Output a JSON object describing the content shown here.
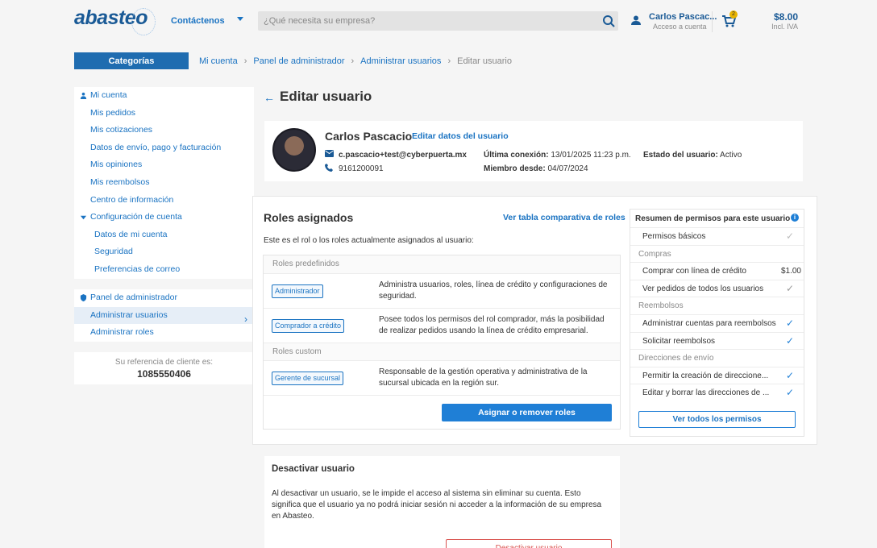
{
  "header": {
    "logo": "abasteo",
    "contact": "Contáctenos",
    "search_placeholder": "¿Qué necesita su empresa?",
    "user_name": "Carlos Pascac...",
    "user_sub": "Acceso a cuenta",
    "cart_count": "2",
    "price": "$8.00",
    "price_sub": "Incl. IVA"
  },
  "nav": {
    "categories": "Categorías",
    "breadcrumbs": [
      "Mi cuenta",
      "Panel de administrador",
      "Administrar usuarios",
      "Editar usuario"
    ]
  },
  "sidebar": {
    "account_head": "Mi cuenta",
    "items": [
      "Mis pedidos",
      "Mis cotizaciones",
      "Datos de envío, pago y facturación",
      "Mis opiniones",
      "Mis reembolsos",
      "Centro de información"
    ],
    "config_head": "Configuración de cuenta",
    "config_items": [
      "Datos de mi cuenta",
      "Seguridad",
      "Preferencias de correo"
    ],
    "admin_head": "Panel de administrador",
    "admin_items": [
      "Administrar usuarios",
      "Administrar roles"
    ],
    "ref_label": "Su referencia de cliente es:",
    "ref_value": "1085550406"
  },
  "page": {
    "title": "Editar usuario"
  },
  "profile": {
    "name": "Carlos Pascacio",
    "edit_link": "Editar datos del usuario",
    "email": "c.pascacio+test@cyberpuerta.mx",
    "phone": "9161200091",
    "last_label": "Última conexión:",
    "last_value": "13/01/2025 11:23 p.m.",
    "since_label": "Miembro desde:",
    "since_value": "04/07/2024",
    "state_label": "Estado del usuario:",
    "state_value": "Activo"
  },
  "roles": {
    "title": "Roles asignados",
    "compare_link": "Ver tabla comparativa de roles",
    "description": "Este es el rol o los roles actualmente asignados al usuario:",
    "predefined_label": "Roles predefinidos",
    "custom_label": "Roles custom",
    "rows": [
      {
        "tag": "Administrador",
        "text": "Administra usuarios, roles, línea de crédito y configuraciones de seguridad."
      },
      {
        "tag": "Comprador a crédito",
        "text": "Posee todos los permisos del rol comprador, más la posibilidad de realizar pedidos usando la línea de crédito empresarial."
      },
      {
        "tag": "Gerente de sucursal",
        "text": "Responsable de la gestión operativa y administrativa de la sucursal ubicada en la región sur."
      }
    ],
    "assign_button": "Asignar o remover roles"
  },
  "permissions": {
    "title": "Resumen de permisos para este usuario",
    "basic": "Permisos básicos",
    "group_compras": "Compras",
    "credit": "Comprar con línea de crédito",
    "credit_value": "$1.00",
    "view_orders": "Ver pedidos de todos los usuarios",
    "group_reembolsos": "Reembolsos",
    "admin_refunds": "Administrar cuentas para reembolsos",
    "request_refunds": "Solicitar reembolsos",
    "group_direcciones": "Direcciones de envío",
    "create_addr": "Permitir la creación de direccione...",
    "edit_addr": "Editar y borrar las direcciones de ...",
    "view_all": "Ver todos los permisos"
  },
  "deactivate": {
    "title": "Desactivar usuario",
    "text": "Al desactivar un usuario, se le impide el acceso al sistema sin eliminar su cuenta. Esto significa que el usuario ya no podrá iniciar sesión ni acceder a la información de su empresa en Abasteo.",
    "button": "Desactivar usuario"
  },
  "colors": {
    "primary": "#1f7fd6",
    "brand": "#1a5a96",
    "danger": "#d9534f"
  }
}
